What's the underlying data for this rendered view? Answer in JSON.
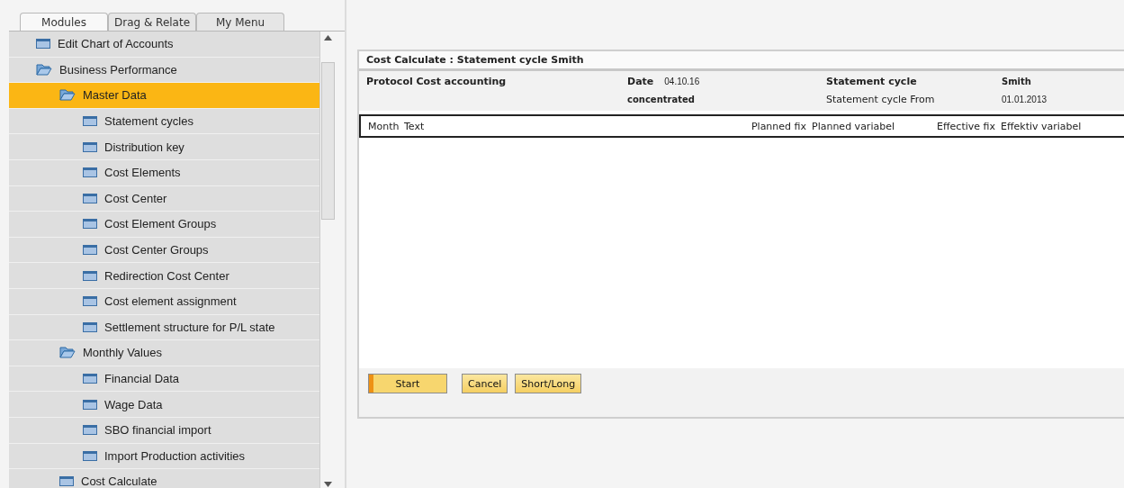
{
  "tabs": [
    {
      "label": "Modules",
      "selected": true
    },
    {
      "label": "Drag & Relate",
      "selected": false
    },
    {
      "label": "My Menu",
      "selected": false
    }
  ],
  "tree": [
    {
      "label": "Edit Chart of Accounts",
      "kind": "form",
      "selected": false
    },
    {
      "label": "Business Performance",
      "kind": "folder",
      "selected": false,
      "children": [
        {
          "label": "Master Data",
          "kind": "folder",
          "selected": true,
          "children": [
            {
              "label": "Statement cycles",
              "kind": "form",
              "selected": false
            },
            {
              "label": "Distribution key",
              "kind": "form",
              "selected": false
            },
            {
              "label": "Cost Elements",
              "kind": "form",
              "selected": false
            },
            {
              "label": "Cost Center",
              "kind": "form",
              "selected": false
            },
            {
              "label": "Cost Element Groups",
              "kind": "form",
              "selected": false
            },
            {
              "label": "Cost Center Groups",
              "kind": "form",
              "selected": false
            },
            {
              "label": "Redirection Cost Center",
              "kind": "form",
              "selected": false
            },
            {
              "label": "Cost element assignment",
              "kind": "form",
              "selected": false
            },
            {
              "label": "Settlement structure for P/L state",
              "kind": "form",
              "selected": false
            }
          ]
        },
        {
          "label": "Monthly Values",
          "kind": "folder",
          "selected": false,
          "children": [
            {
              "label": "Financial Data",
              "kind": "form",
              "selected": false
            },
            {
              "label": "Wage Data",
              "kind": "form",
              "selected": false
            },
            {
              "label": "SBO financial import",
              "kind": "form",
              "selected": false
            },
            {
              "label": "Import Production activities",
              "kind": "form",
              "selected": false
            }
          ]
        },
        {
          "label": "Cost Calculate",
          "kind": "form",
          "selected": false
        }
      ]
    }
  ],
  "dialog": {
    "title": "Cost Calculate : Statement cycle Smith",
    "report_title": "Protocol Cost accounting",
    "date_label": "Date",
    "date": "04.10.16",
    "mode": "concentrated",
    "cycle_label": "Statement cycle",
    "cycle": "Smith",
    "from_label": "Statement cycle From",
    "from": "01.01.2013",
    "columns": [
      "Month",
      "Text",
      "Planned fix",
      "Planned variabel",
      "Effective fix",
      "Effektiv variabel"
    ],
    "buttons": [
      {
        "label": "Start",
        "kind": "primary"
      },
      {
        "label": "Cancel",
        "kind": "normal"
      },
      {
        "label": "Short/Long",
        "kind": "normal"
      }
    ]
  }
}
